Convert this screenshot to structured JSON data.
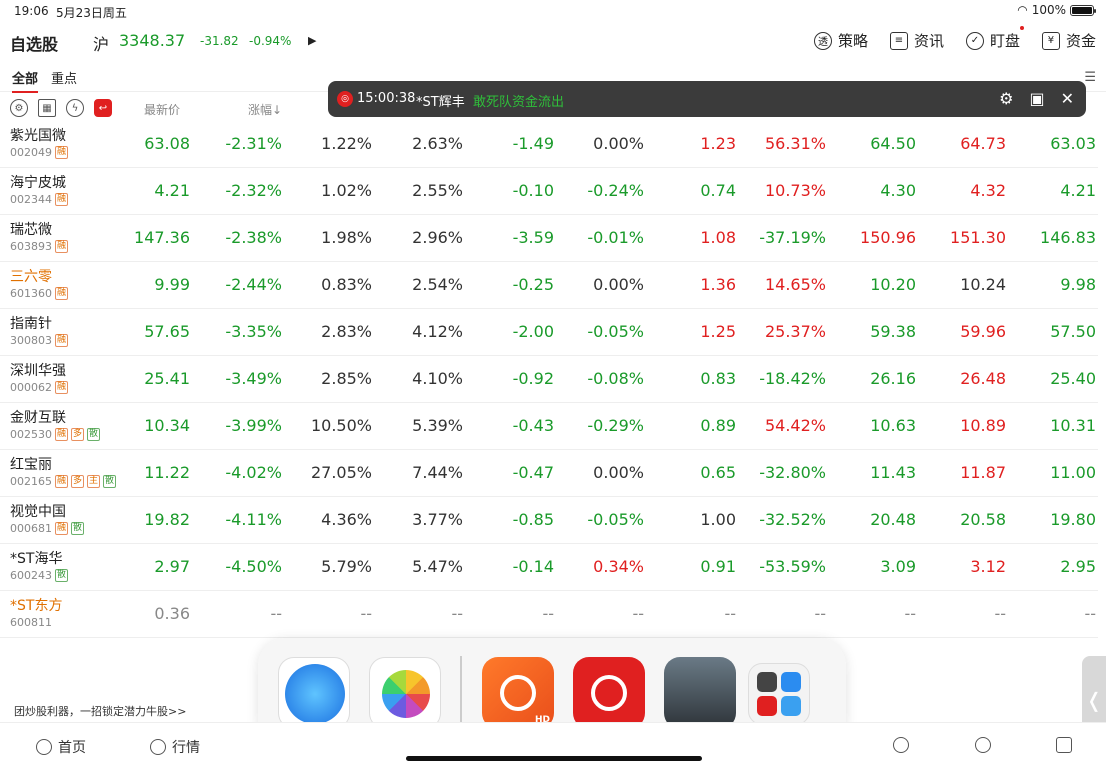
{
  "status": {
    "time": "19:06",
    "date": "5月23日周五",
    "battery": "100%"
  },
  "header": {
    "title": "自选股",
    "index_name": "沪",
    "index_value": "3348.37",
    "index_change": "-31.82",
    "index_pct": "-0.94%",
    "nav": [
      {
        "label": "策略",
        "icon": "strategy-icon"
      },
      {
        "label": "资讯",
        "icon": "news-icon"
      },
      {
        "label": "盯盘",
        "icon": "watch-icon"
      },
      {
        "label": "资金",
        "icon": "yen-icon"
      }
    ]
  },
  "tabs": [
    "全部",
    "重点"
  ],
  "columns": {
    "price": "最新价",
    "pct": "涨幅↓"
  },
  "banner": {
    "time": "15:00:38",
    "stock": "*ST辉丰",
    "message": "敢死队资金流出"
  },
  "rows": [
    {
      "name": "紫光国微",
      "code": "002049",
      "tags": [
        "融"
      ],
      "c": [
        "63.08",
        "-2.31%",
        "1.22%",
        "2.63%",
        "-1.49",
        "0.00%",
        "1.23",
        "56.31%",
        "64.50",
        "64.73",
        "63.03"
      ],
      "k": [
        "down",
        "down",
        "flat",
        "flat",
        "down",
        "flat",
        "up",
        "up",
        "down",
        "up",
        "down"
      ]
    },
    {
      "name": "海宁皮城",
      "code": "002344",
      "tags": [
        "融"
      ],
      "c": [
        "4.21",
        "-2.32%",
        "1.02%",
        "2.55%",
        "-0.10",
        "-0.24%",
        "0.74",
        "10.73%",
        "4.30",
        "4.32",
        "4.21"
      ],
      "k": [
        "down",
        "down",
        "flat",
        "flat",
        "down",
        "down",
        "down",
        "up",
        "down",
        "up",
        "down"
      ]
    },
    {
      "name": "瑞芯微",
      "code": "603893",
      "tags": [
        "融"
      ],
      "c": [
        "147.36",
        "-2.38%",
        "1.98%",
        "2.96%",
        "-3.59",
        "-0.01%",
        "1.08",
        "-37.19%",
        "150.96",
        "151.30",
        "146.83"
      ],
      "k": [
        "down",
        "down",
        "flat",
        "flat",
        "down",
        "down",
        "up",
        "down",
        "up",
        "up",
        "down"
      ]
    },
    {
      "name": "三六零",
      "code": "601360",
      "tags": [
        "融"
      ],
      "orange": true,
      "c": [
        "9.99",
        "-2.44%",
        "0.83%",
        "2.54%",
        "-0.25",
        "0.00%",
        "1.36",
        "14.65%",
        "10.20",
        "10.24",
        "9.98"
      ],
      "k": [
        "down",
        "down",
        "flat",
        "flat",
        "down",
        "flat",
        "up",
        "up",
        "down",
        "flat",
        "down"
      ]
    },
    {
      "name": "指南针",
      "code": "300803",
      "tags": [
        "融"
      ],
      "c": [
        "57.65",
        "-3.35%",
        "2.83%",
        "4.12%",
        "-2.00",
        "-0.05%",
        "1.25",
        "25.37%",
        "59.38",
        "59.96",
        "57.50"
      ],
      "k": [
        "down",
        "down",
        "flat",
        "flat",
        "down",
        "down",
        "up",
        "up",
        "down",
        "up",
        "down"
      ]
    },
    {
      "name": "深圳华强",
      "code": "000062",
      "tags": [
        "融"
      ],
      "c": [
        "25.41",
        "-3.49%",
        "2.85%",
        "4.10%",
        "-0.92",
        "-0.08%",
        "0.83",
        "-18.42%",
        "26.16",
        "26.48",
        "25.40"
      ],
      "k": [
        "down",
        "down",
        "flat",
        "flat",
        "down",
        "down",
        "down",
        "down",
        "down",
        "up",
        "down"
      ]
    },
    {
      "name": "金财互联",
      "code": "002530",
      "tags": [
        "融",
        "多",
        "散"
      ],
      "c": [
        "10.34",
        "-3.99%",
        "10.50%",
        "5.39%",
        "-0.43",
        "-0.29%",
        "0.89",
        "54.42%",
        "10.63",
        "10.89",
        "10.31"
      ],
      "k": [
        "down",
        "down",
        "flat",
        "flat",
        "down",
        "down",
        "down",
        "up",
        "down",
        "up",
        "down"
      ]
    },
    {
      "name": "红宝丽",
      "code": "002165",
      "tags": [
        "融",
        "多",
        "主",
        "散"
      ],
      "c": [
        "11.22",
        "-4.02%",
        "27.05%",
        "7.44%",
        "-0.47",
        "0.00%",
        "0.65",
        "-32.80%",
        "11.43",
        "11.87",
        "11.00"
      ],
      "k": [
        "down",
        "down",
        "flat",
        "flat",
        "down",
        "flat",
        "down",
        "down",
        "down",
        "up",
        "down"
      ]
    },
    {
      "name": "视觉中国",
      "code": "000681",
      "tags": [
        "融",
        "散"
      ],
      "c": [
        "19.82",
        "-4.11%",
        "4.36%",
        "3.77%",
        "-0.85",
        "-0.05%",
        "1.00",
        "-32.52%",
        "20.48",
        "20.58",
        "19.80"
      ],
      "k": [
        "down",
        "down",
        "flat",
        "flat",
        "down",
        "down",
        "flat",
        "down",
        "down",
        "down",
        "down"
      ]
    },
    {
      "name": "*ST海华",
      "code": "600243",
      "tags": [
        "散"
      ],
      "c": [
        "2.97",
        "-4.50%",
        "5.79%",
        "5.47%",
        "-0.14",
        "0.34%",
        "0.91",
        "-53.59%",
        "3.09",
        "3.12",
        "2.95"
      ],
      "k": [
        "down",
        "down",
        "flat",
        "flat",
        "down",
        "up",
        "down",
        "down",
        "down",
        "up",
        "down"
      ]
    },
    {
      "name": "*ST东方",
      "code": "600811",
      "tags": [],
      "orange": true,
      "c": [
        "0.36",
        "--",
        "--",
        "--",
        "--",
        "--",
        "--",
        "--",
        "--",
        "--",
        "--"
      ],
      "k": [
        "muted",
        "muted",
        "muted",
        "muted",
        "muted",
        "muted",
        "muted",
        "muted",
        "muted",
        "muted",
        "muted"
      ]
    }
  ],
  "promo": "团炒股利器，一招锁定潜力牛股>>",
  "tabbar": {
    "home": "首页",
    "market": "行情"
  },
  "colors": {
    "up": "#e02020",
    "down": "#1a9a2a",
    "accent": "#e02020"
  }
}
